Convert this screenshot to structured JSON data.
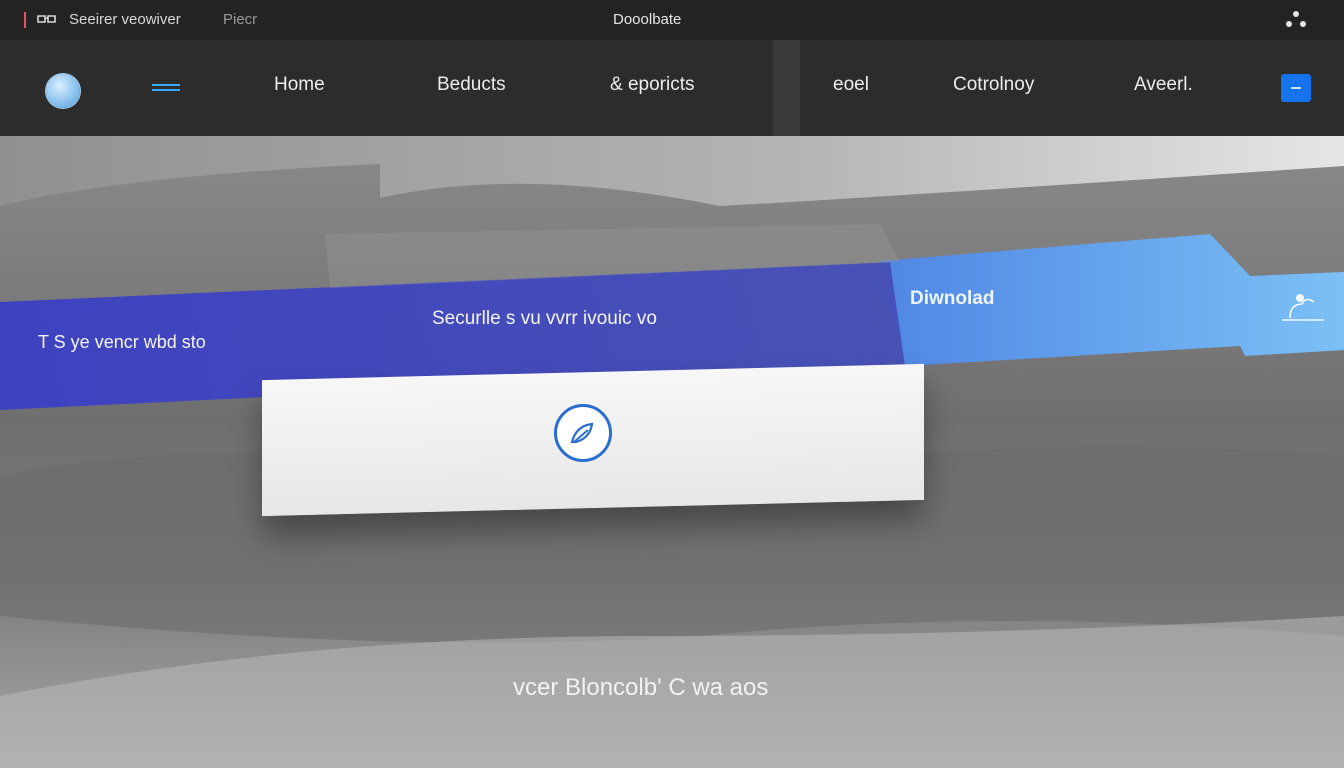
{
  "topbar": {
    "site_name": "Seeirer veowiver",
    "site_sub": "Piecr",
    "center_title": "Dooolbate"
  },
  "nav": {
    "items": [
      {
        "label": "Home"
      },
      {
        "label": "Beducts"
      },
      {
        "label": "& eporicts"
      },
      {
        "label": "eoel"
      },
      {
        "label": "Cotrolnoy"
      },
      {
        "label": "Aveerl."
      }
    ]
  },
  "hero": {
    "band_left": "T S ye vencr wbd sto",
    "band_center": "Securlle s vu vvrr ivouic vo",
    "download": "Diwnolad",
    "caption": "vcer Bloncolb' C wa aos"
  },
  "colors": {
    "accent": "#1673ee",
    "band_deep": "#3a3fbf",
    "band_light": "#5aa6f0",
    "menu": "#38a8ff",
    "emblem": "#2a6dd1"
  },
  "icons": {
    "top_glyph": "glasses-icon",
    "top_right": "dots-icon",
    "nav_logo": "globe-logo",
    "nav_menu": "menu-icon",
    "card_emblem": "leaf-emblem-icon",
    "cloud_right": "cloud-icon"
  }
}
